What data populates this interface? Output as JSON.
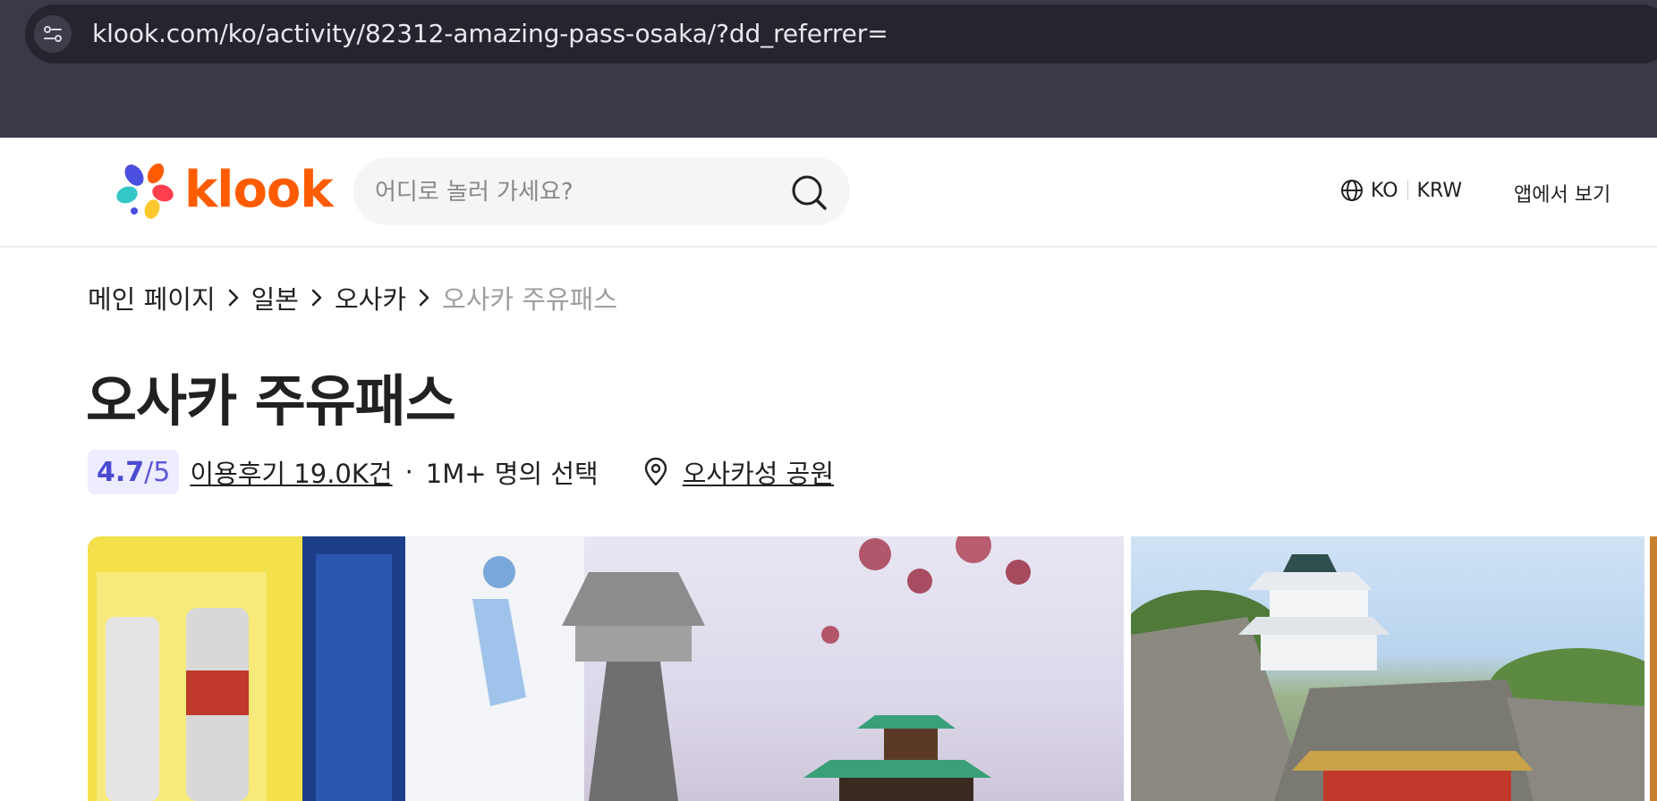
{
  "browser": {
    "url": "klook.com/ko/activity/82312-amazing-pass-osaka/?dd_referrer=",
    "site_settings_icon": "tune-icon"
  },
  "header": {
    "logo_text": "klook",
    "search_placeholder": "어디로 놀러 가세요?",
    "locale_language": "KO",
    "locale_currency": "KRW",
    "app_link": "앱에서 보기"
  },
  "breadcrumb": {
    "items": [
      "메인 페이지",
      "일본",
      "오사카"
    ],
    "current": "오사카 주유패스"
  },
  "title": "오사카 주유패스",
  "meta": {
    "rating": "4.7",
    "rating_denominator": "/5",
    "reviews": "이용후기 19.0K건",
    "separator": "·",
    "booked": "1M+ 명의 선택",
    "location": "오사카성 공원"
  },
  "colors": {
    "brand": "#ff5b00",
    "rating_text": "#4b4ad1",
    "rating_bg": "#eeecff",
    "chrome_bg": "#3b3848"
  }
}
